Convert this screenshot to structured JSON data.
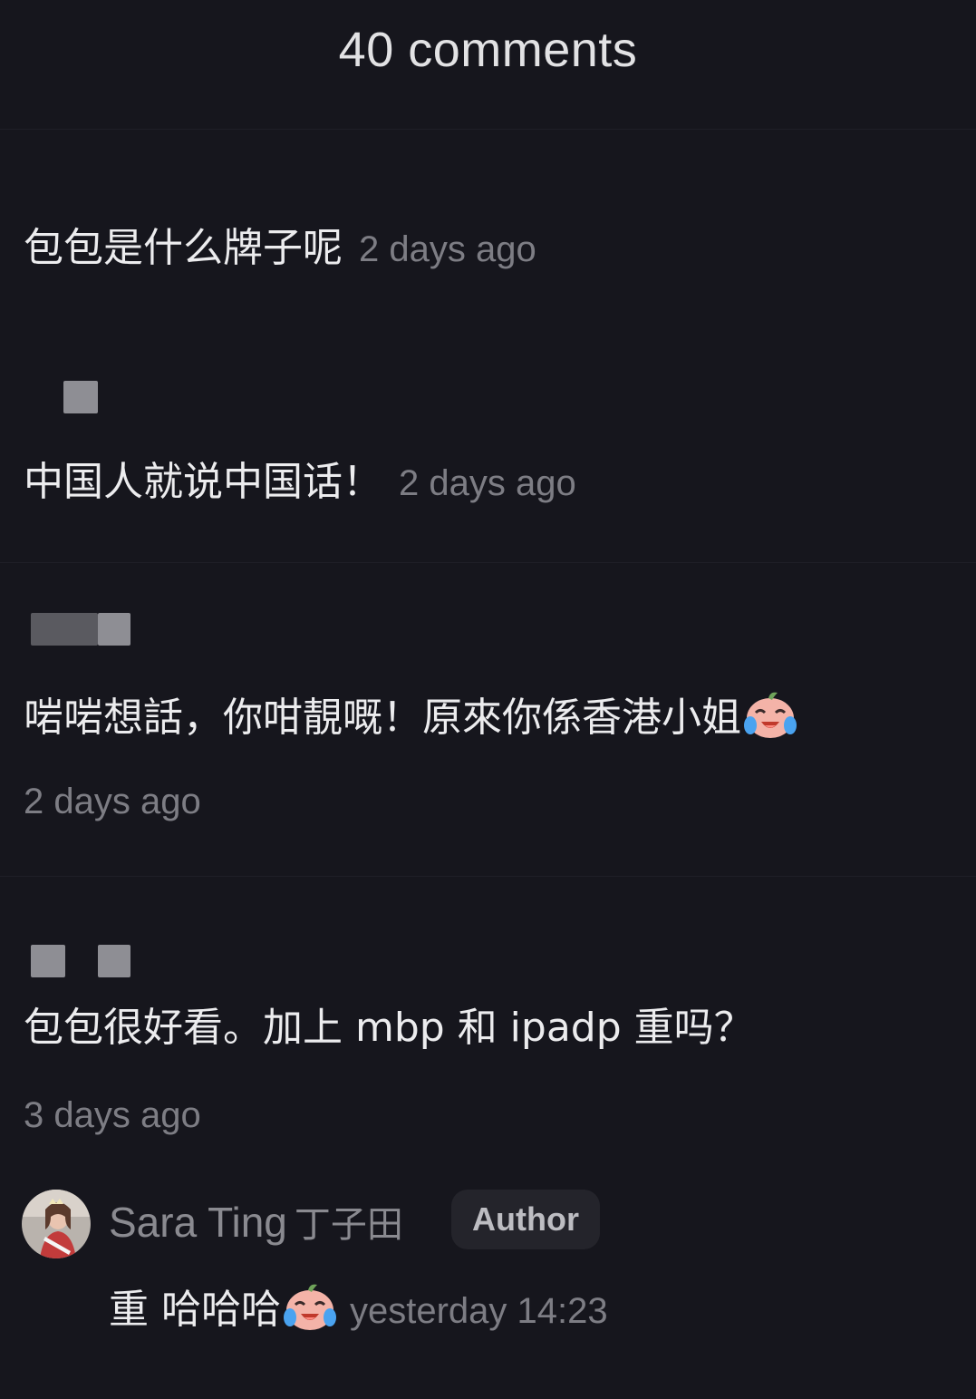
{
  "header": {
    "title": "40 comments"
  },
  "comments": [
    {
      "text": "包包是什么牌子呢",
      "time": "2 days ago"
    },
    {
      "text": "中国人就说中国话！",
      "time": "2 days ago"
    },
    {
      "text": "啱啱想話，你咁靚嘅！原來你係香港小姐",
      "emoji": "crying-laughing-face-icon",
      "time": "2 days ago"
    },
    {
      "text": "包包很好看。加上 mbp 和 ipadp 重吗？",
      "time": "3 days ago"
    }
  ],
  "reply": {
    "author_name": "Sara Ting",
    "author_name_cjk": "丁子田",
    "badge": "Author",
    "text": "重 哈哈哈",
    "emoji": "crying-laughing-face-icon",
    "time": "yesterday 14:23"
  },
  "colors": {
    "background": "#16161d",
    "text": "#ececee",
    "muted": "#7d7d84",
    "badge_bg": "#24242b"
  }
}
